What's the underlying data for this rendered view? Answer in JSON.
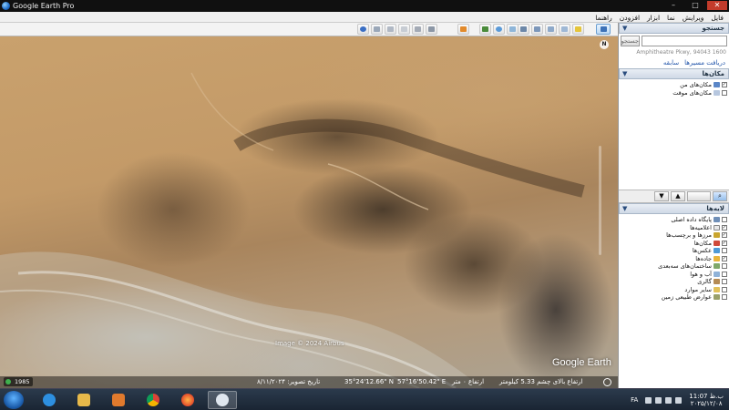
{
  "window": {
    "title": "Google Earth Pro",
    "controls": {
      "minimize": "–",
      "maximize": "□",
      "close": "✕"
    }
  },
  "menu": [
    "فایل",
    "ویرایش",
    "نما",
    "ابزار",
    "افزودن",
    "راهنما"
  ],
  "toolbar": {
    "left_buttons": [
      "sun-icon",
      "photo-icon",
      "ruler-icon",
      "email-icon",
      "print-icon",
      "save-image-icon",
      "maps-icon"
    ],
    "right_buttons": [
      "placemark-icon",
      "polygon-icon",
      "path-icon",
      "overlay-icon",
      "record-tour-icon",
      "historical-imagery-icon",
      "sunlight-icon",
      "planets-icon",
      "ruler2-icon"
    ]
  },
  "map": {
    "compass": "N",
    "imagery_credit": "Image © 2024 Airbus",
    "logo": "Google Earth",
    "year": "1985",
    "status": {
      "date": "تاریخ تصویر: ۸/۱۱/۲۰۲۴",
      "lat": "35°24'12.66\" N",
      "lon": "57°16'50.42\" E",
      "elev": "ارتفاع ۰ متر",
      "eye_alt": "ارتفاع بالای چشم 5.33 کیلومتر"
    }
  },
  "search": {
    "header": "جستجو",
    "button": "جستجو",
    "placeholder": "",
    "hint": "Amphitheatre Pkwy, 94043 1600",
    "tabs": [
      "دریافت مسیرها",
      "سابقه"
    ]
  },
  "places": {
    "header": "مکان‌ها",
    "items": [
      {
        "label": "مکان‌های من",
        "checked": true
      },
      {
        "label": "مکان‌های موقت",
        "checked": false
      }
    ]
  },
  "layers": {
    "header": "لایه‌ها",
    "items": [
      {
        "label": "پایگاه داده اصلی",
        "checked": false
      },
      {
        "label": "اعلامیه‌ها",
        "checked": true
      },
      {
        "label": "مرزها و برچسب‌ها",
        "checked": true
      },
      {
        "label": "مکان‌ها",
        "checked": true
      },
      {
        "label": "عکس‌ها",
        "checked": false
      },
      {
        "label": "جاده‌ها",
        "checked": true
      },
      {
        "label": "ساختمان‌های سه‌بعدی",
        "checked": false
      },
      {
        "label": "آب و هوا",
        "checked": false
      },
      {
        "label": "گالری",
        "checked": false
      },
      {
        "label": "سایر موارد",
        "checked": false
      },
      {
        "label": "عوارض طبیعی زمین",
        "checked": false
      }
    ]
  },
  "taskbar": {
    "lang": "FA",
    "time": "11:07 ب.ظ",
    "date": "۲۰۲۵/۱۲/۰۸"
  },
  "colors": {
    "taskbar": "#1a2533",
    "sidebar_header": "#cfd9e6",
    "close": "#c23b2b"
  }
}
